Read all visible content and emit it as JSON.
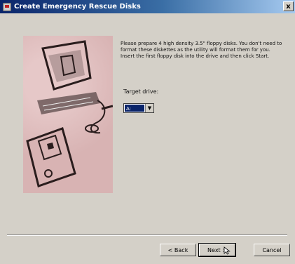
{
  "window": {
    "title": "Create Emergency Rescue Disks",
    "close_symbol": "x"
  },
  "instructions": {
    "line1": "Please prepare 4 high density 3.5\" floppy disks. You don't need to format these diskettes as the utility will format them for you.",
    "line2": "Insert the first floppy disk into the drive and then click Start."
  },
  "target_drive": {
    "label": "Target drive:",
    "selected": "A:",
    "arrow_symbol": "▼"
  },
  "buttons": {
    "back": "< Back",
    "next": "Next >",
    "cancel": "Cancel"
  },
  "colors": {
    "title_active": "#0a246a",
    "art_background": "#d8b3b3"
  }
}
